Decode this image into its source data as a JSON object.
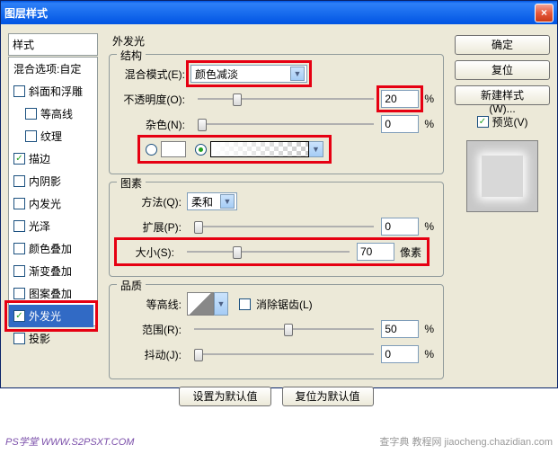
{
  "dialog": {
    "title": "图层样式"
  },
  "left": {
    "header": "样式",
    "blend_defaults": "混合选项:自定",
    "items": [
      {
        "label": "斜面和浮雕",
        "checked": false,
        "indent": false
      },
      {
        "label": "等高线",
        "checked": false,
        "indent": true
      },
      {
        "label": "纹理",
        "checked": false,
        "indent": true
      },
      {
        "label": "描边",
        "checked": true,
        "indent": false
      },
      {
        "label": "内阴影",
        "checked": false,
        "indent": false
      },
      {
        "label": "内发光",
        "checked": false,
        "indent": false
      },
      {
        "label": "光泽",
        "checked": false,
        "indent": false
      },
      {
        "label": "颜色叠加",
        "checked": false,
        "indent": false
      },
      {
        "label": "渐变叠加",
        "checked": false,
        "indent": false
      },
      {
        "label": "图案叠加",
        "checked": false,
        "indent": false
      },
      {
        "label": "外发光",
        "checked": true,
        "indent": false,
        "selected": true
      },
      {
        "label": "投影",
        "checked": false,
        "indent": false
      }
    ]
  },
  "main": {
    "title": "外发光",
    "structure": {
      "heading": "结构",
      "blend_mode_label": "混合模式(E):",
      "blend_mode_value": "颜色减淡",
      "opacity_label": "不透明度(O):",
      "opacity_value": "20",
      "opacity_unit": "%",
      "noise_label": "杂色(N):",
      "noise_value": "0",
      "noise_unit": "%"
    },
    "elements": {
      "heading": "图素",
      "technique_label": "方法(Q):",
      "technique_value": "柔和",
      "spread_label": "扩展(P):",
      "spread_value": "0",
      "spread_unit": "%",
      "size_label": "大小(S):",
      "size_value": "70",
      "size_unit": "像素"
    },
    "quality": {
      "heading": "品质",
      "contour_label": "等高线:",
      "antialias_label": "消除锯齿(L)",
      "range_label": "范围(R):",
      "range_value": "50",
      "range_unit": "%",
      "jitter_label": "抖动(J):",
      "jitter_value": "0",
      "jitter_unit": "%"
    },
    "buttons": {
      "default": "设置为默认值",
      "reset": "复位为默认值"
    }
  },
  "right": {
    "ok": "确定",
    "cancel": "复位",
    "new_style": "新建样式(W)...",
    "preview": "预览(V)"
  },
  "footer": {
    "left": "PS学堂  WWW.S2PSXT.COM",
    "right": "查字典 教程网  jiaocheng.chazidian.com"
  }
}
